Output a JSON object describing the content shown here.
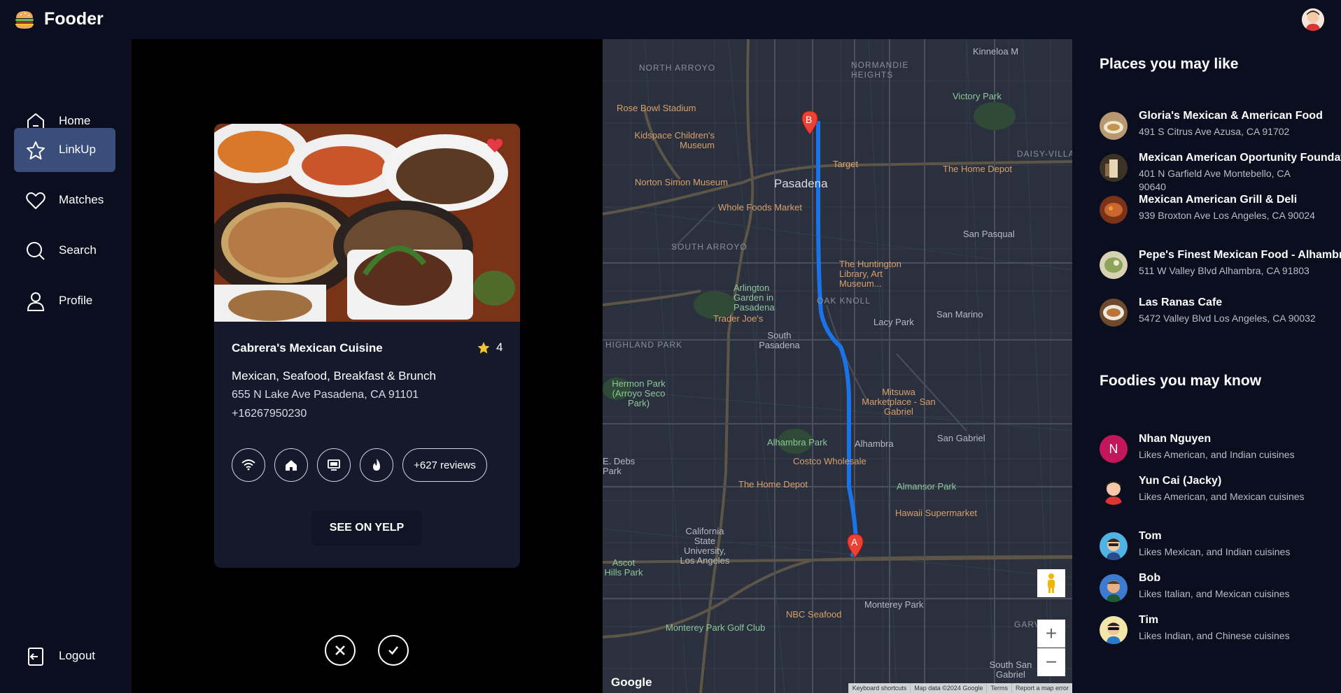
{
  "app": {
    "name": "Fooder"
  },
  "sidebar": {
    "items": [
      {
        "label": "Home",
        "icon": "home-icon"
      },
      {
        "label": "LinkUp",
        "icon": "star-icon",
        "active": true
      },
      {
        "label": "Matches",
        "icon": "heart-icon"
      },
      {
        "label": "Search",
        "icon": "search-icon"
      },
      {
        "label": "Profile",
        "icon": "user-icon"
      }
    ],
    "logout": "Logout"
  },
  "card": {
    "title": "Cabrera's Mexican Cuisine",
    "rating": "4",
    "categories": "Mexican, Seafood, Breakfast & Brunch",
    "address": "655 N Lake Ave Pasadena, CA 91101",
    "phone": "+16267950230",
    "amenities": [
      "wifi-icon",
      "home-icon",
      "tv-icon",
      "fire-icon"
    ],
    "reviews": "+627 reviews",
    "yelp_button": "SEE ON YELP",
    "favorited": true
  },
  "map": {
    "labels": {
      "north_arroyo": "NORTH ARROYO",
      "normandie_heights": "NORMANDIE HEIGHTS",
      "rose_bowl": "Rose Bowl Stadium",
      "childrens_museum": "Kidspace Children's Museum",
      "norton_simon": "Norton Simon Museum",
      "pasadena": "Pasadena",
      "target": "Target",
      "whole_foods": "Whole Foods Market",
      "home_depot_top": "The Home Depot",
      "victory_park": "Victory Park",
      "daisy_villa": "DAISY-VILLA",
      "south_arroyo": "SOUTH ARROYO",
      "san_pasqual": "San Pasqual",
      "huntington": "The Huntington Library, Art Museum...",
      "arlington_garden": "Arlington Garden in Pasadena",
      "trader_joes": "Trader Joe's",
      "south_pasadena": "South Pasadena",
      "oak_knoll": "OAK KNOLL",
      "lacy_park": "Lacy Park",
      "san_marino": "San Marino",
      "highland_park": "HIGHLAND PARK",
      "hermon_park": "Hermon Park (Arroyo Seco Park)",
      "mitsuwa": "Mitsuwa Marketplace - San Gabriel",
      "alhambra_park": "Alhambra Park",
      "alhambra": "Alhambra",
      "san_gabriel": "San Gabriel",
      "costco": "Costco Wholesale",
      "home_depot_bottom": "The Home Depot",
      "almansor": "Almansor Park",
      "hawaii_super": "Hawaii Supermarket",
      "csula": "California State University, Los Angeles",
      "ascot_hills": "Ascot Hills Park",
      "nbc_seafood": "NBC Seafood",
      "monterey_park": "Monterey Park",
      "monterey_golf": "Monterey Park Golf Club",
      "garvey": "GARVEY",
      "south_san_gabriel": "South San Gabriel",
      "kinneloa": "Kinneloa M",
      "debs": "E. Debs Park",
      "marker_a": "A",
      "marker_b": "B"
    },
    "google": "Google",
    "footer": [
      "Keyboard shortcuts",
      "Map data ©2024 Google",
      "Terms",
      "Report a map error"
    ]
  },
  "places": {
    "title": "Places you may like",
    "items": [
      {
        "name": "Gloria's Mexican & American Food",
        "address": "491 S Citrus Ave Azusa, CA 91702"
      },
      {
        "name": "Mexican American Oportunity Foundation",
        "address": "401 N Garfield Ave Montebello, CA 90640"
      },
      {
        "name": "Mexican American Grill & Deli",
        "address": "939 Broxton Ave Los Angeles, CA 90024"
      },
      {
        "name": "Pepe's Finest Mexican Food - Alhambra",
        "address": "511 W Valley Blvd Alhambra, CA 91803"
      },
      {
        "name": "Las Ranas Cafe",
        "address": "5472 Valley Blvd Los Angeles, CA 90032"
      }
    ]
  },
  "foodies": {
    "title": "Foodies you may know",
    "items": [
      {
        "name": "Nhan Nguyen",
        "likes": "Likes American, and Indian cuisines",
        "initial": "N"
      },
      {
        "name": "Yun Cai (Jacky)",
        "likes": "Likes American, and Mexican cuisines"
      },
      {
        "name": "Tom",
        "likes": "Likes Mexican, and Indian cuisines"
      },
      {
        "name": "Bob",
        "likes": "Likes Italian, and Mexican cuisines"
      },
      {
        "name": "Tim",
        "likes": "Likes Indian, and Chinese cuisines"
      }
    ]
  },
  "colors": {
    "accent": "#3b4d7a",
    "route": "#1a73e8",
    "marker": "#ea4335",
    "card": "#141a2c"
  }
}
